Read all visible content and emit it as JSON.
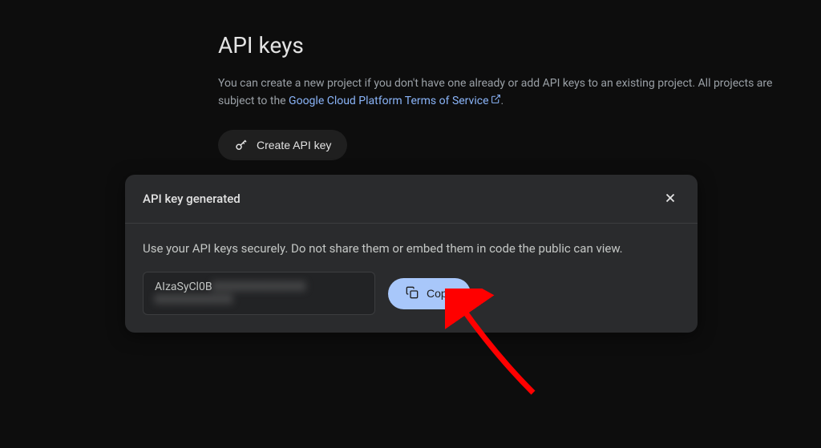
{
  "page": {
    "title": "API keys",
    "description_part1": "You can create a new project if you don't have one already or add API keys to an existing project. All projects are subject to the ",
    "tos_link_text": "Google Cloud Platform Terms of Service",
    "description_part2": "."
  },
  "buttons": {
    "create_api_key": "Create API key",
    "copy": "Copy"
  },
  "modal": {
    "title": "API key generated",
    "body_text": "Use your API keys securely. Do not share them or embed them in code the public can view.",
    "key_visible": "AIzaSyCl0B",
    "key_hidden": "XXXXXXXXXXXX  XXXXXXXXXX"
  }
}
